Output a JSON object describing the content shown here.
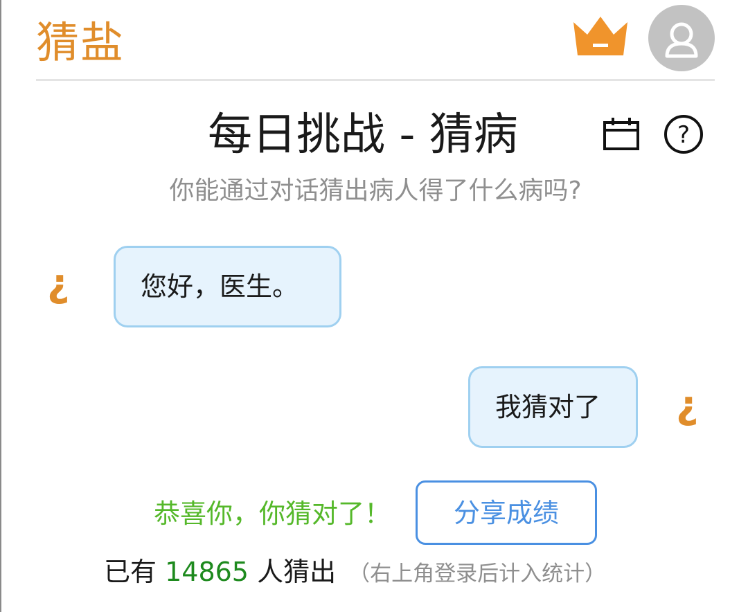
{
  "header": {
    "app_title": "猜盐",
    "crown_icon": "crown-icon",
    "avatar_icon": "user-icon",
    "accent_color": "#e08d2b"
  },
  "challenge": {
    "title": "每日挑战 - 猜病",
    "calendar_icon": "calendar-icon",
    "help_icon": "question-circle-icon",
    "subtitle": "你能通过对话猜出病人得了什么病吗?"
  },
  "messages": [
    {
      "sender": "patient",
      "icon": "¿",
      "text": "您好，医生。"
    },
    {
      "sender": "user",
      "icon": "¿",
      "text": "我猜对了"
    }
  ],
  "result": {
    "congrats": "恭喜你，你猜对了！",
    "share_label": "分享成绩"
  },
  "stats": {
    "prefix": "已有 ",
    "count": "14865",
    "suffix": " 人猜出",
    "note": "（右上角登录后计入统计）"
  }
}
